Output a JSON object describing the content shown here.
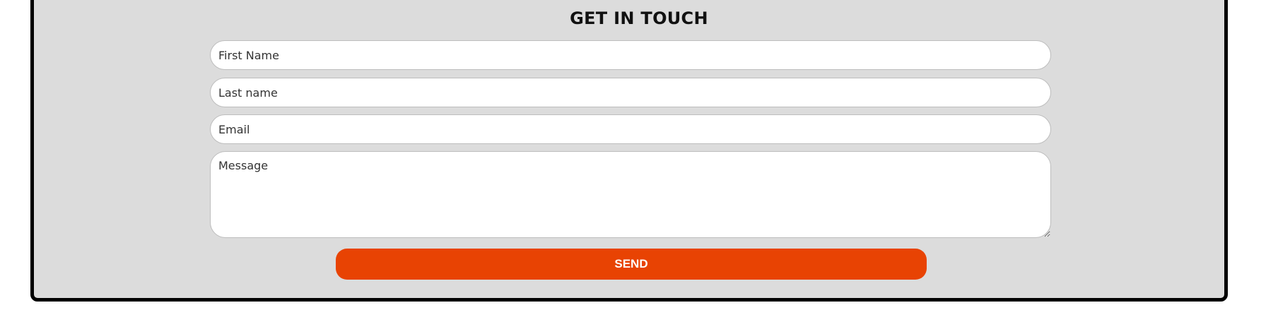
{
  "contact_form": {
    "title": "GET IN TOUCH",
    "first_name_placeholder": "First Name",
    "last_name_placeholder": "Last name",
    "email_placeholder": "Email",
    "message_placeholder": "Message",
    "send_label": "SEND"
  },
  "colors": {
    "panel_background": "#dcdcdc",
    "panel_border": "#000000",
    "send_button": "#e84303",
    "send_text": "#ffffff"
  }
}
